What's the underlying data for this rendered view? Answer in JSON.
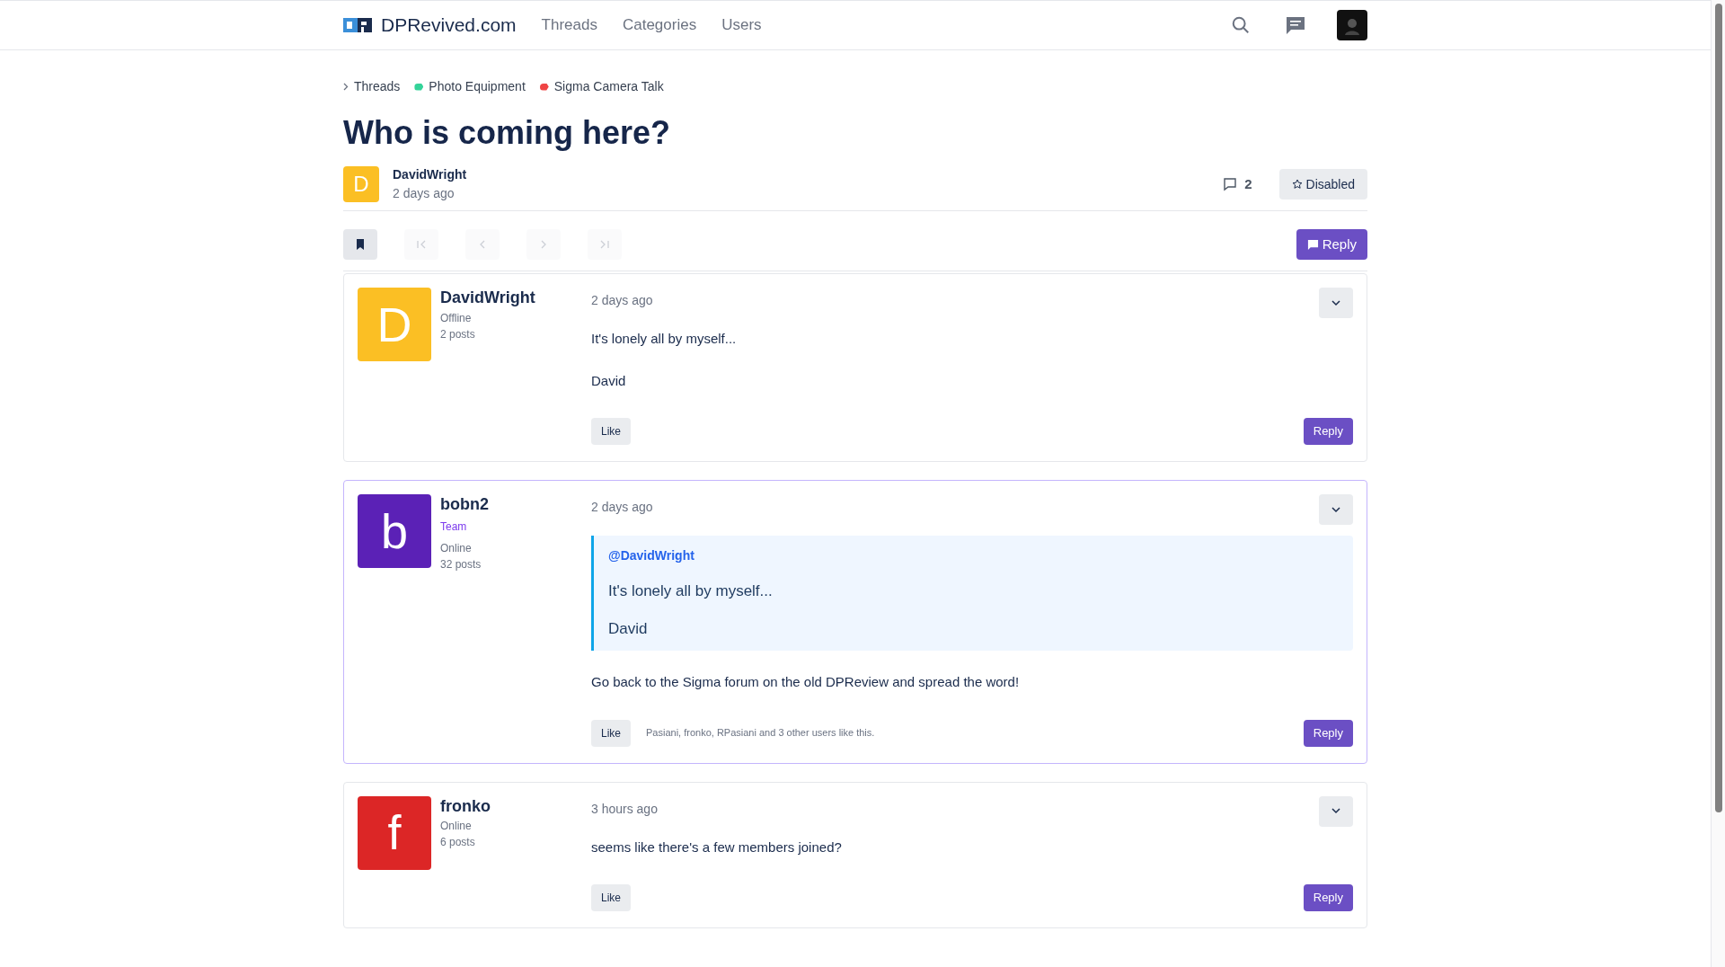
{
  "header": {
    "site_name": "DPRevived.com",
    "nav": [
      {
        "label": "Threads"
      },
      {
        "label": "Categories"
      },
      {
        "label": "Users"
      }
    ]
  },
  "breadcrumb": [
    {
      "label": "Threads",
      "kind": "chevron"
    },
    {
      "label": "Photo Equipment",
      "kind": "tag",
      "color": "#34d399"
    },
    {
      "label": "Sigma Camera Talk",
      "kind": "tag",
      "color": "#ef4444"
    }
  ],
  "thread": {
    "title": "Who is coming here?",
    "author": "DavidWright",
    "author_initial": "D",
    "color": "#fbbf24",
    "time": "2 days ago",
    "reply_count": "2",
    "watch_label": "Disabled"
  },
  "pager": [
    {
      "kind": "bookmark",
      "disabled": false
    },
    {
      "kind": "first",
      "disabled": true
    },
    {
      "kind": "prev",
      "disabled": true
    },
    {
      "kind": "next",
      "disabled": true
    },
    {
      "kind": "last",
      "disabled": true
    }
  ],
  "reply_button": "Reply",
  "posts": [
    {
      "author": "DavidWright",
      "initial": "D",
      "color": "#fbbf24",
      "status": "Offline",
      "posts": "2 posts",
      "time": "2 days ago",
      "highlighted": false,
      "body": [
        {
          "kind": "text",
          "text": "It's lonely all by myself..."
        },
        {
          "kind": "text",
          "text": "David"
        }
      ],
      "like": "Like",
      "reply": "Reply"
    },
    {
      "author": "bobn2",
      "initial": "b",
      "color": "#5b21b6",
      "role": "Team",
      "status": "Online",
      "posts": "32 posts",
      "time": "2 days ago",
      "highlighted": true,
      "body": [
        {
          "kind": "quote",
          "mention": "@DavidWright",
          "lines": [
            "It's lonely all by myself...",
            "David"
          ]
        },
        {
          "kind": "text",
          "text": "Go back to the Sigma forum on the old DPReview and spread the word!"
        }
      ],
      "like": "Like",
      "likes_text": "Pasiani, fronko, RPasiani and 3 other users like this.",
      "reply": "Reply"
    },
    {
      "author": "fronko",
      "initial": "f",
      "color": "#dc2626",
      "status": "Online",
      "posts": "6 posts",
      "time": "3 hours ago",
      "highlighted": false,
      "body": [
        {
          "kind": "text",
          "text": "seems like there's a few members joined?"
        }
      ],
      "like": "Like",
      "reply": "Reply"
    }
  ]
}
